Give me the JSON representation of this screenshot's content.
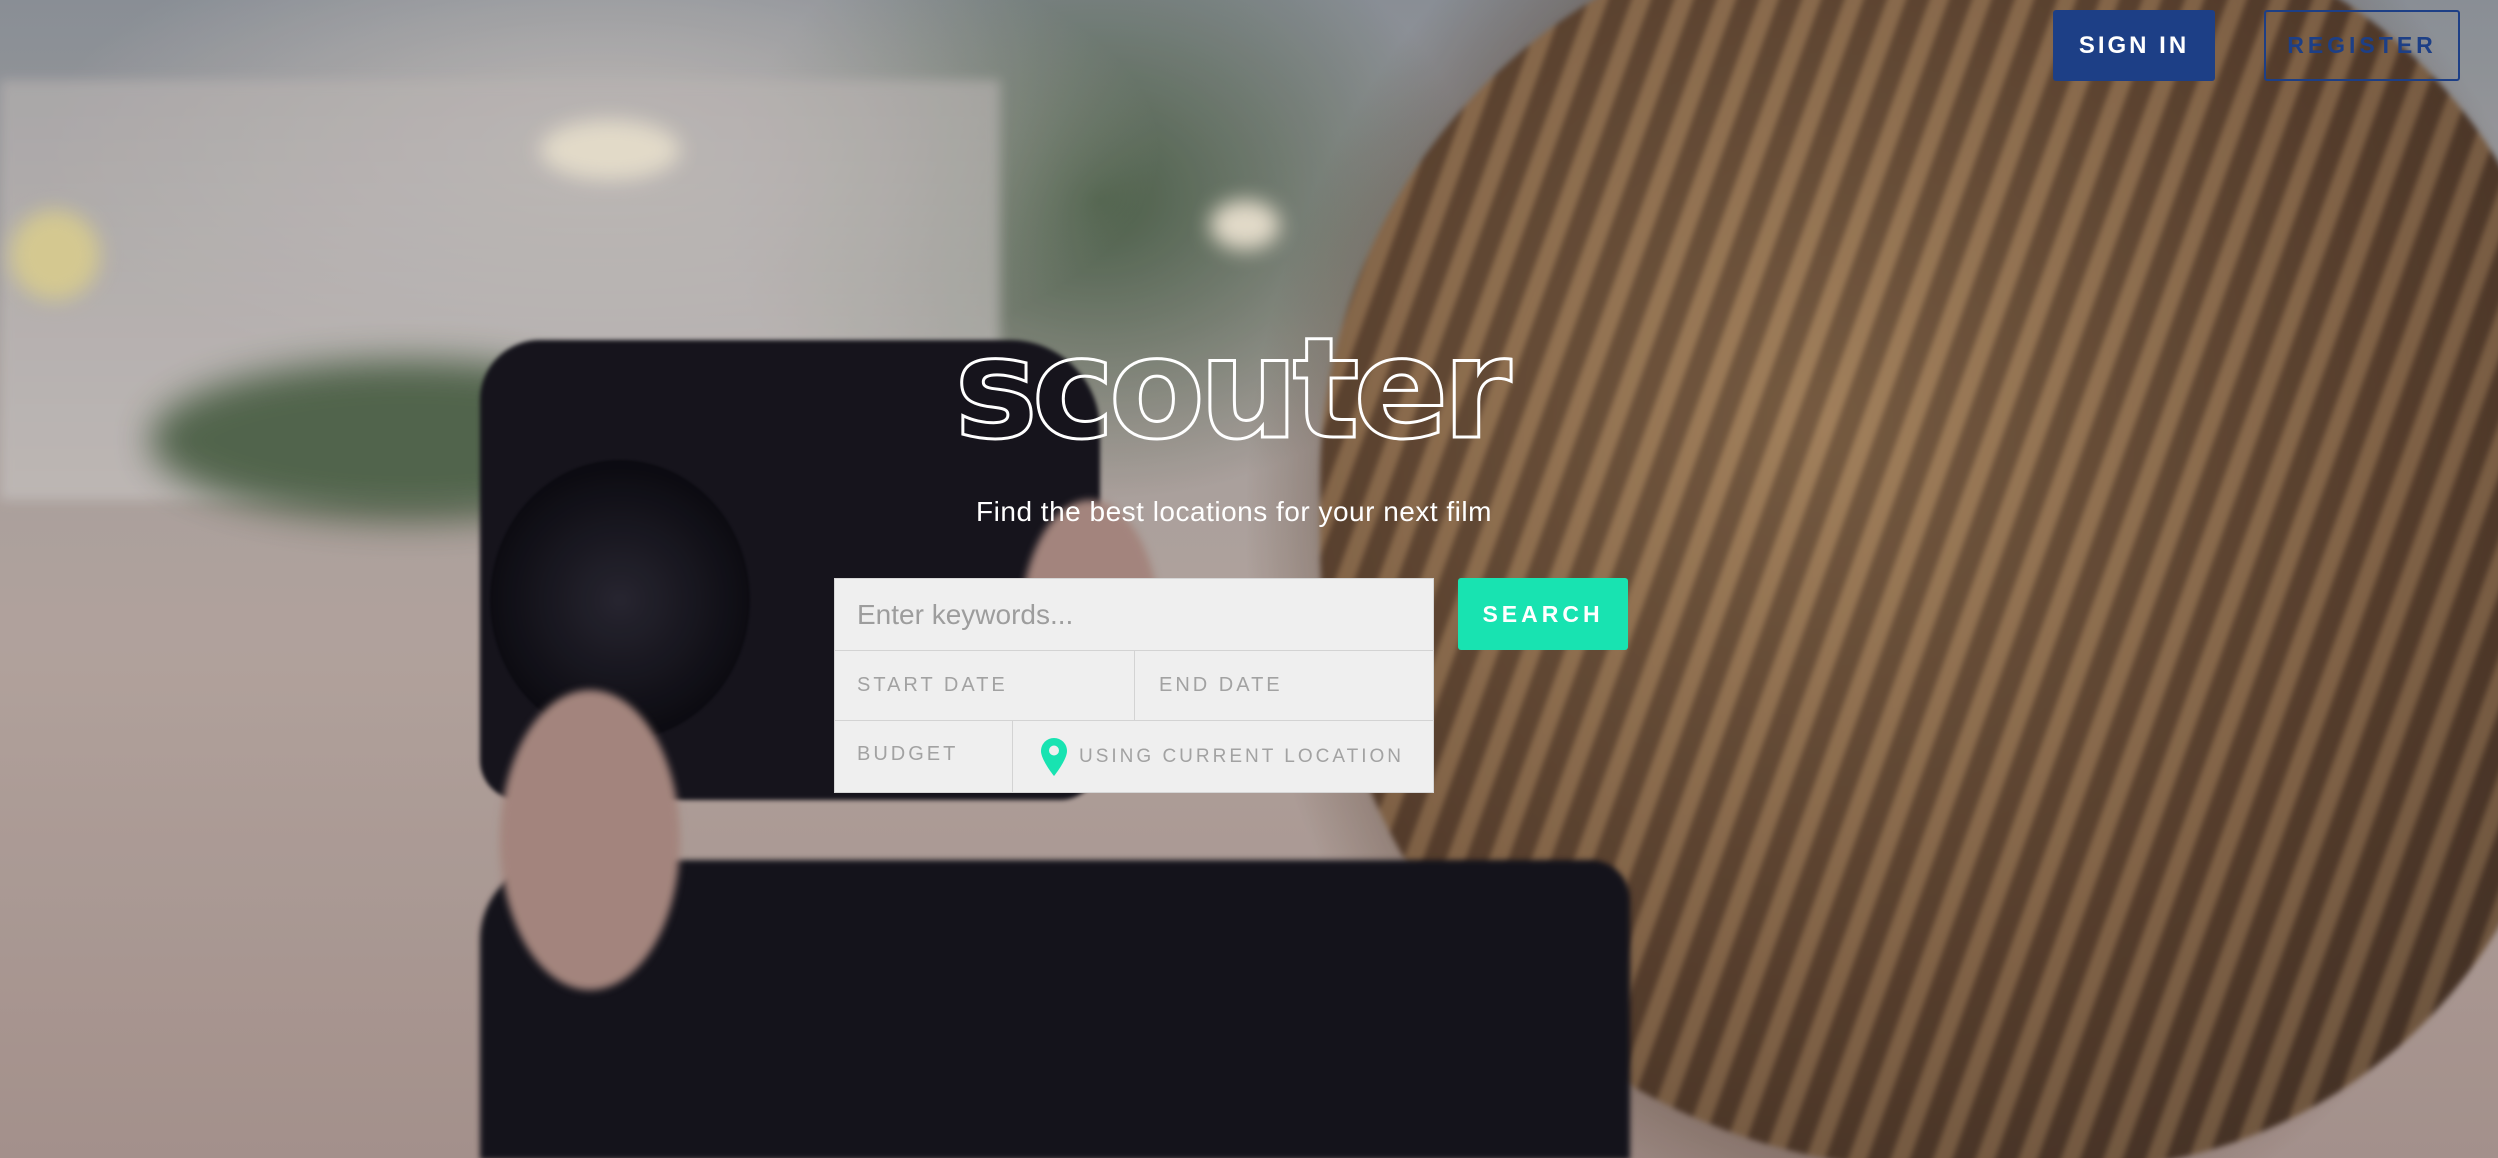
{
  "header": {
    "sign_in_label": "SIGN IN",
    "register_label": "REGISTER"
  },
  "hero": {
    "logo_text": "scouter",
    "tagline": "Find the best locations for your next film"
  },
  "search": {
    "keywords_placeholder": "Enter keywords...",
    "start_date_label": "START DATE",
    "end_date_label": "END DATE",
    "budget_label": "BUDGET",
    "location_label": "USING CURRENT LOCATION",
    "search_button_label": "SEARCH"
  },
  "colors": {
    "primary_navy": "#1d3f86",
    "accent_teal": "#18e3b1"
  },
  "icons": {
    "location": "map-pin-icon"
  }
}
